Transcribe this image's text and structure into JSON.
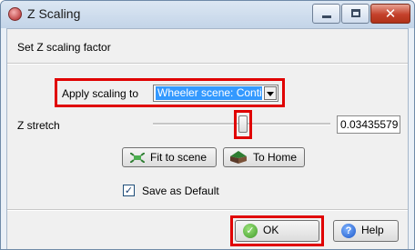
{
  "window": {
    "title": "Z Scaling"
  },
  "header": {
    "text": "Set Z scaling factor"
  },
  "apply": {
    "label": "Apply scaling to",
    "selected": "Wheeler scene: Conti"
  },
  "stretch": {
    "label": "Z stretch",
    "value": "0.03435579",
    "slider_fraction": 0.52
  },
  "buttons": {
    "fit": "Fit to scene",
    "home": "To Home",
    "ok": "OK",
    "help": "Help"
  },
  "default_checkbox": {
    "label": "Save as Default",
    "checked": true
  },
  "colors": {
    "highlight": "#e00000",
    "selection": "#3399ff",
    "close_button": "#c4412b"
  }
}
